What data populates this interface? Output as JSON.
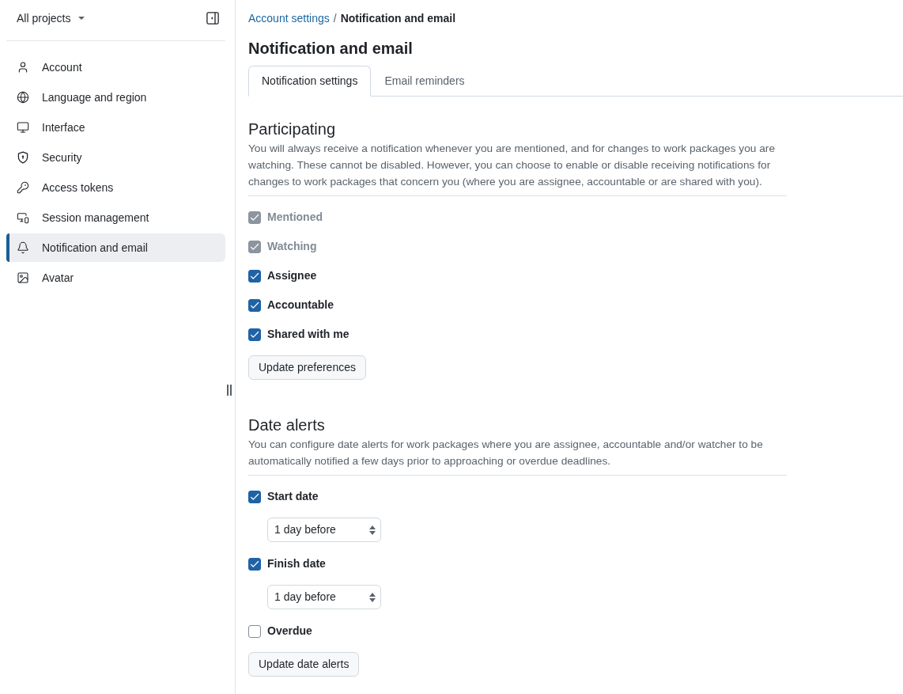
{
  "sidebar": {
    "project_selector": "All projects",
    "items": [
      {
        "label": "Account",
        "selected": false
      },
      {
        "label": "Language and region",
        "selected": false
      },
      {
        "label": "Interface",
        "selected": false
      },
      {
        "label": "Security",
        "selected": false
      },
      {
        "label": "Access tokens",
        "selected": false
      },
      {
        "label": "Session management",
        "selected": false
      },
      {
        "label": "Notification and email",
        "selected": true
      },
      {
        "label": "Avatar",
        "selected": false
      }
    ]
  },
  "breadcrumb": {
    "parent": "Account settings",
    "separator": "/",
    "current": "Notification and email"
  },
  "page_title": "Notification and email",
  "tabs": [
    {
      "label": "Notification settings",
      "selected": true
    },
    {
      "label": "Email reminders",
      "selected": false
    }
  ],
  "sections": [
    {
      "title": "Participating",
      "description": "You will always receive a notification whenever you are mentioned, and for changes to work packages you are watching. These cannot be disabled. However, you can choose to enable or disable receiving notifications for changes to work packages that concern you (where you are assignee, accountable or are shared with you).",
      "options": [
        {
          "label": "Mentioned",
          "checked": true,
          "disabled": true
        },
        {
          "label": "Watching",
          "checked": true,
          "disabled": true
        },
        {
          "label": "Assignee",
          "checked": true,
          "disabled": false
        },
        {
          "label": "Accountable",
          "checked": true,
          "disabled": false
        },
        {
          "label": "Shared with me",
          "checked": true,
          "disabled": false
        }
      ],
      "button": "Update preferences"
    },
    {
      "title": "Date alerts",
      "description": "You can configure date alerts for work packages where you are assignee, accountable and/or watcher to be automatically notified a few days prior to approaching or overdue deadlines.",
      "options": [
        {
          "label": "Start date",
          "checked": true,
          "disabled": false,
          "select": "1 day before"
        },
        {
          "label": "Finish date",
          "checked": true,
          "disabled": false,
          "select": "1 day before"
        },
        {
          "label": "Overdue",
          "checked": false,
          "disabled": false
        }
      ],
      "button": "Update date alerts"
    }
  ]
}
